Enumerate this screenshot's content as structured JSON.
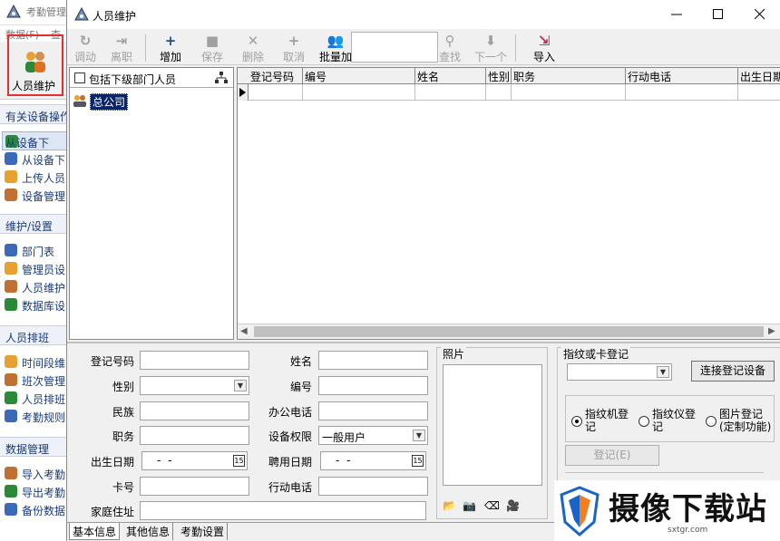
{
  "background_window": {
    "title": "考勤管理",
    "menu": [
      "数据(F)",
      "查"
    ],
    "big_button_label": "人员维护",
    "nav": [
      {
        "section": "有关设备操作",
        "items": [
          "从设备下",
          "从设备下",
          "上传人员",
          "设备管理"
        ]
      },
      {
        "section": "维护/设置",
        "items": [
          "部门表",
          "管理员设",
          "人员维护",
          "数据库设"
        ]
      },
      {
        "section": "人员排班",
        "items": [
          "时间段维",
          "班次管理",
          "人员排班",
          "考勤规则"
        ]
      },
      {
        "section": "数据管理",
        "items": [
          "导入考勤",
          "导出考勤",
          "备份数据"
        ]
      }
    ]
  },
  "dialog": {
    "title": "人员维护",
    "toolbar": [
      {
        "label": "调动",
        "icon": "refresh-icon",
        "enabled": false
      },
      {
        "label": "离职",
        "icon": "person-leave-icon",
        "enabled": false
      },
      {
        "label": "增加",
        "icon": "plus-icon",
        "enabled": true
      },
      {
        "label": "保存",
        "icon": "save-icon",
        "enabled": false
      },
      {
        "label": "删除",
        "icon": "x-icon",
        "enabled": false
      },
      {
        "label": "取消",
        "icon": "plus-icon",
        "enabled": false
      },
      {
        "label": "批量加",
        "icon": "people-icon",
        "enabled": true
      },
      {
        "label": "查找",
        "icon": "search-pin-icon",
        "enabled": false
      },
      {
        "label": "下一个",
        "icon": "arrow-down-icon",
        "enabled": false
      },
      {
        "label": "导入",
        "icon": "import-icon",
        "enabled": true
      }
    ],
    "search_value": "",
    "tree": {
      "include_sub_label": "包括下级部门人员",
      "include_sub_checked": false,
      "root_node": "总公司"
    },
    "grid": {
      "columns": [
        "登记号码",
        "编号",
        "姓名",
        "性别",
        "职务",
        "行动电话",
        "出生日期"
      ]
    },
    "form": {
      "fields_left": [
        {
          "label": "登记号码",
          "value": ""
        },
        {
          "label": "性别",
          "value": ""
        },
        {
          "label": "民族",
          "value": ""
        },
        {
          "label": "职务",
          "value": ""
        },
        {
          "label": "出生日期",
          "value": "-  -"
        },
        {
          "label": "卡号",
          "value": ""
        },
        {
          "label": "家庭住址",
          "value": ""
        }
      ],
      "fields_mid": [
        {
          "label": "姓名",
          "value": ""
        },
        {
          "label": "编号",
          "value": ""
        },
        {
          "label": "办公电话",
          "value": ""
        },
        {
          "label": "设备权限",
          "value": "一般用户"
        },
        {
          "label": "聘用日期",
          "value": "-  -"
        },
        {
          "label": "行动电话",
          "value": ""
        }
      ],
      "calendar_glyph": "15",
      "photo_label": "照片",
      "finger_label": "指纹或卡登记",
      "connect_button": "连接登记设备",
      "radios": [
        {
          "label": "指纹机登记",
          "checked": true
        },
        {
          "label": "指纹仪登记",
          "checked": false
        },
        {
          "label": "图片登记(定制功能)",
          "checked": false
        }
      ],
      "register_button": "登记(E)"
    },
    "tabs": [
      "基本信息",
      "其他信息",
      "考勤设置"
    ],
    "active_tab": 0
  },
  "watermark": {
    "text": "摄像下载站",
    "url": "sxtgr.com"
  },
  "colors": {
    "selection": "#0a246a",
    "highlight_border": "#e03030",
    "nav_text": "#1a3a78"
  }
}
